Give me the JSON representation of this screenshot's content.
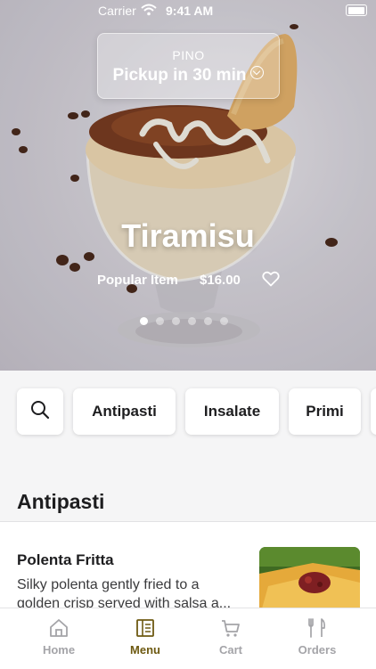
{
  "status": {
    "carrier": "Carrier",
    "time": "9:41 AM"
  },
  "pickup": {
    "store": "PINO",
    "when": "Pickup in 30 min"
  },
  "hero": {
    "title": "Tiramisu",
    "subtitle": "Popular Item",
    "price": "$16.00",
    "slide_count": 6,
    "active_slide": 1
  },
  "categories": [
    "Antipasti",
    "Insalate",
    "Primi"
  ],
  "section": {
    "title": "Antipasti"
  },
  "items": [
    {
      "name": "Polenta Fritta",
      "description": "Silky polenta gently fried to a golden crisp served with salsa a..."
    }
  ],
  "tabs": [
    {
      "label": "Home",
      "icon": "home-icon",
      "active": false
    },
    {
      "label": "Menu",
      "icon": "menu-icon",
      "active": true
    },
    {
      "label": "Cart",
      "icon": "cart-icon",
      "active": false
    },
    {
      "label": "Orders",
      "icon": "orders-icon",
      "active": false
    }
  ],
  "colors": {
    "accent": "#6e5a12",
    "inactive_tab": "#a4a4a8",
    "background": "#f5f5f6"
  }
}
